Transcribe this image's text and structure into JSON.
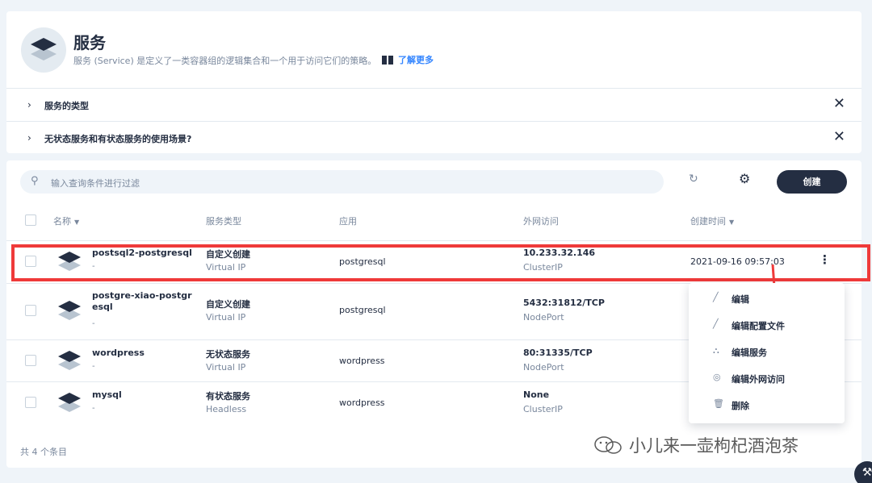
{
  "header": {
    "title": "服务",
    "description": "服务 (Service) 是定义了一类容器组的逻辑集合和一个用于访问它们的策略。",
    "learn_more": "了解更多"
  },
  "faq": [
    {
      "label": "服务的类型"
    },
    {
      "label": "无状态服务和有状态服务的使用场景?"
    }
  ],
  "toolbar": {
    "search_placeholder": "输入查询条件进行过滤",
    "create_label": "创建"
  },
  "table": {
    "columns": [
      "名称",
      "服务类型",
      "应用",
      "外网访问",
      "创建时间"
    ],
    "rows": [
      {
        "name": "postsql2-postgresql",
        "name_sub": "-",
        "type": "自定义创建",
        "type_sub": "Virtual IP",
        "app": "postgresql",
        "ext": "10.233.32.146",
        "ext_sub": "ClusterIP",
        "time": "2021-09-16 09:57:03"
      },
      {
        "name": "postgre-xiao-postgresql",
        "name_sub": "-",
        "type": "自定义创建",
        "type_sub": "Virtual IP",
        "app": "postgresql",
        "ext": "5432:31812/TCP",
        "ext_sub": "NodePort",
        "time": ""
      },
      {
        "name": "wordpress",
        "name_sub": "-",
        "type": "无状态服务",
        "type_sub": "Virtual IP",
        "app": "wordpress",
        "ext": "80:31335/TCP",
        "ext_sub": "NodePort",
        "time": ""
      },
      {
        "name": "mysql",
        "name_sub": "-",
        "type": "有状态服务",
        "type_sub": "Headless",
        "app": "wordpress",
        "ext": "None",
        "ext_sub": "ClusterIP",
        "time": ""
      }
    ],
    "total": "共 4 个条目"
  },
  "menu": {
    "items": [
      {
        "label": "编辑",
        "icon": "pencil-icon"
      },
      {
        "label": "编辑配置文件",
        "icon": "pencil-icon"
      },
      {
        "label": "编辑服务",
        "icon": "service-icon"
      },
      {
        "label": "编辑外网访问",
        "icon": "globe-icon"
      },
      {
        "label": "删除",
        "icon": "trash-icon"
      }
    ]
  },
  "watermark": "小儿来一壶枸杞酒泡茶",
  "colors": {
    "primary": "#242e42",
    "accent": "#3385ff",
    "highlight": "#ef3a3a",
    "bg": "#eff4f9"
  }
}
